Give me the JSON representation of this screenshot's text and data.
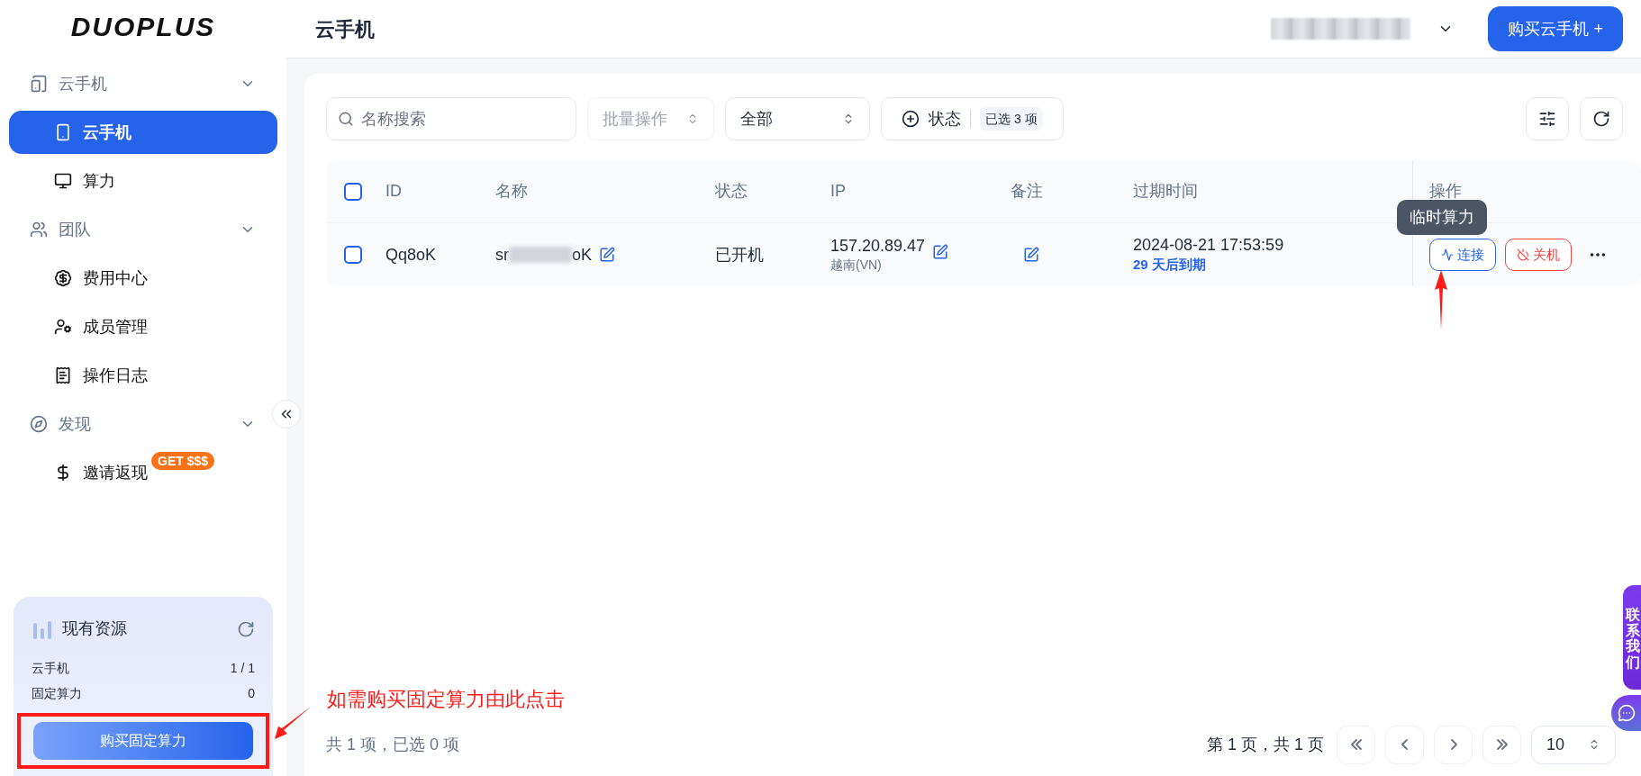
{
  "logo": {
    "text": "DUOPLUS"
  },
  "sidebar": {
    "groups": [
      {
        "label": "云手机",
        "expanded": true,
        "items": [
          {
            "label": "云手机",
            "selected": true
          },
          {
            "label": "算力",
            "selected": false
          }
        ]
      },
      {
        "label": "团队",
        "expanded": true,
        "items": [
          {
            "label": "费用中心",
            "selected": false
          },
          {
            "label": "成员管理",
            "selected": false
          },
          {
            "label": "操作日志",
            "selected": false
          }
        ]
      },
      {
        "label": "发现",
        "expanded": true,
        "items": [
          {
            "label": "邀请返现",
            "selected": false,
            "badge": "GET $$$"
          }
        ]
      }
    ]
  },
  "resources": {
    "title": "现有资源",
    "rows": [
      {
        "label": "云手机",
        "value": "1 / 1"
      },
      {
        "label": "固定算力",
        "value": "0"
      }
    ],
    "button": "购买固定算力"
  },
  "header": {
    "title": "云手机",
    "buy_button": "购买云手机 +"
  },
  "toolbar": {
    "search_placeholder": "名称搜索",
    "batch": {
      "label": "批量操作",
      "disabled": true
    },
    "filter": "全部",
    "status_filter": {
      "label": "状态",
      "selected_count": "已选 3 项"
    }
  },
  "table": {
    "select_all_checked": false,
    "columns": [
      "ID",
      "名称",
      "状态",
      "IP",
      "备注",
      "过期时间",
      "操作"
    ],
    "rows": [
      {
        "checked": false,
        "id": "Qq8oK",
        "name_start": "sr",
        "name_end": "oK",
        "status": "已开机",
        "ip": "157.20.89.47",
        "region": "越南(VN)",
        "expiry": "2024-08-21 17:53:59",
        "remaining": "29 天后到期",
        "actions": [
          {
            "label": "连接",
            "kind": "primary"
          },
          {
            "label": "关机",
            "kind": "danger"
          }
        ]
      }
    ]
  },
  "tooltip": "临时算力",
  "footer": {
    "summary": "共 1 项，已选 0 项",
    "page_info": "第 1 页，共 1 页",
    "page_size": "10"
  },
  "contact_tab": "联系我们",
  "annotation": "如需购买固定算力由此点击"
}
